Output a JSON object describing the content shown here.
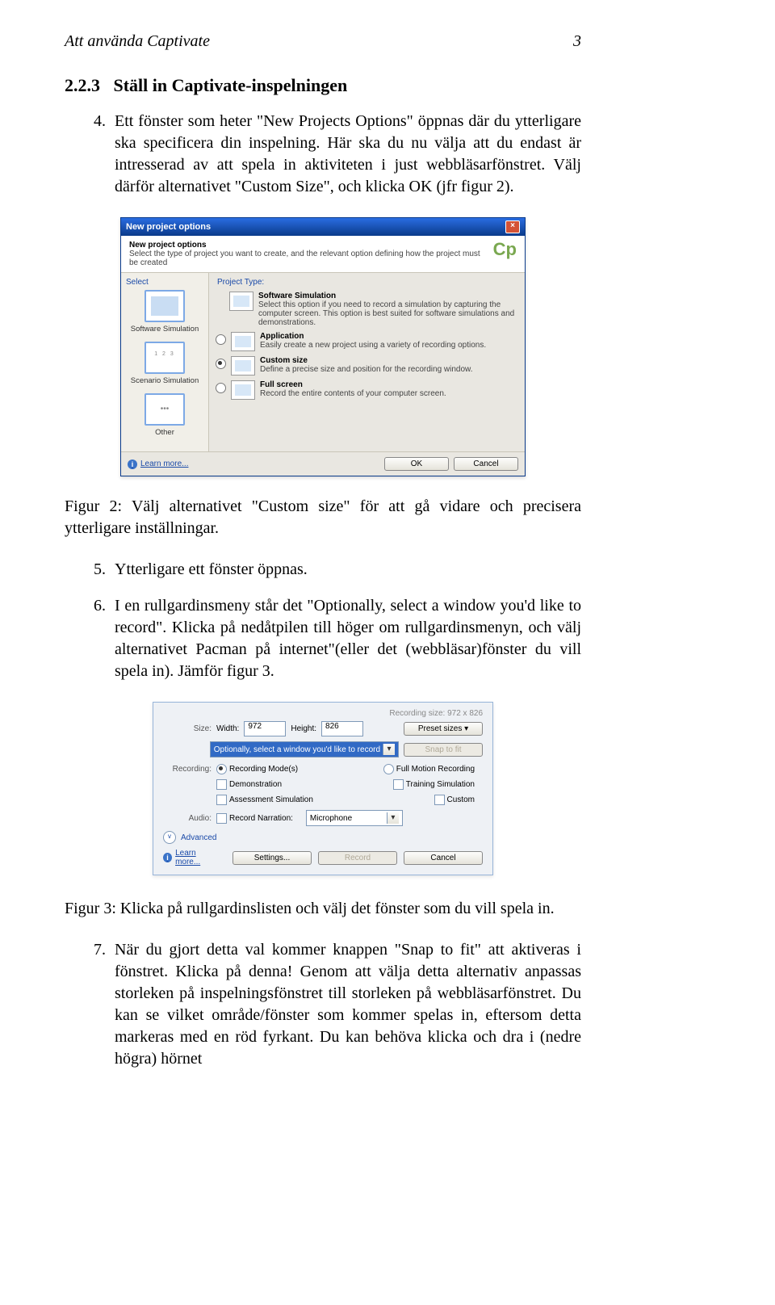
{
  "header": {
    "title": "Att använda Captivate",
    "pageno": "3"
  },
  "section": {
    "number": "2.2.3",
    "title": "Ställ in Captivate-inspelningen"
  },
  "steps": {
    "s4": "Ett fönster som heter \"New Projects Options\" öppnas där du ytterligare ska specificera din inspelning. Här ska du nu välja att du endast är intresserad av att spela in aktiviteten i just webbläsarfönstret. Välj därför alternativet \"Custom Size\", och klicka OK (jfr figur 2).",
    "s5": "Ytterligare ett fönster öppnas.",
    "s6": "I en rullgardinsmeny står det \"Optionally, select a window you'd like to record\". Klicka på nedåtpilen till höger om rullgardinsmenyn, och välj alternativet Pacman på internet\"(eller det (webbläsar)fönster du vill spela in). Jämför figur 3.",
    "s7": "När du gjort detta val kommer knappen \"Snap to fit\" att aktiveras i fönstret. Klicka på denna! Genom att välja detta alternativ anpassas storleken på inspelningsfönstret till storleken på webbläsarfönstret. Du kan se vilket område/fönster som kommer spelas in, eftersom detta markeras med en röd fyrkant. Du kan behöva klicka och dra i (nedre högra) hörnet"
  },
  "fig2_caption": "Figur 2: Välj alternativet \"Custom size\" för att gå vidare och precisera ytterligare inställningar.",
  "fig3_caption": "Figur 3: Klicka på rullgardinslisten och välj det fönster som du vill spela in.",
  "dlg": {
    "title": "New project options",
    "sub_title": "New project options",
    "sub_desc": "Select the type of project you want to create, and the relevant option defining how the project must be created",
    "logo": "Cp",
    "left": {
      "header": "Select",
      "items": [
        "Software Simulation",
        "Scenario Simulation",
        "Other"
      ]
    },
    "right": {
      "header": "Project Type:",
      "opts": [
        {
          "title": "Software Simulation",
          "desc": "Select this option if you need to record a simulation by capturing the computer screen. This option is best suited for software simulations and demonstrations."
        },
        {
          "title": "Application",
          "desc": "Easily create a new project using a variety of recording options."
        },
        {
          "title": "Custom size",
          "desc": "Define a precise size and position for the recording window."
        },
        {
          "title": "Full screen",
          "desc": "Record the entire contents of your computer screen."
        }
      ]
    },
    "learn": "Learn more...",
    "ok": "OK",
    "cancel": "Cancel"
  },
  "rec": {
    "topright": "Recording size: 972 x 826",
    "size_label": "Size:",
    "width_label": "Width:",
    "width_val": "972",
    "height_label": "Height:",
    "height_val": "826",
    "preset_btn": "Preset sizes ▾",
    "sel_window": "Optionally, select a window you'd like to record",
    "snap_btn": "Snap to fit",
    "recording_label": "Recording:",
    "rm": "Recording Mode(s)",
    "fmr": "Full Motion Recording",
    "demo": "Demonstration",
    "train": "Training Simulation",
    "assess": "Assessment Simulation",
    "custom": "Custom",
    "audio_label": "Audio:",
    "narration": "Record Narration:",
    "mic": "Microphone",
    "advanced": "Advanced",
    "learn": "Learn more...",
    "settings": "Settings...",
    "record": "Record",
    "cancel": "Cancel"
  }
}
